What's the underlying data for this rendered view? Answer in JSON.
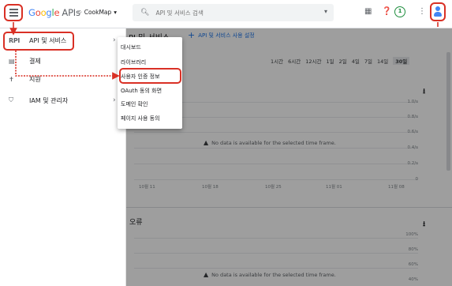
{
  "header": {
    "logo_letters": [
      "G",
      "o",
      "o",
      "g",
      "l",
      "e"
    ],
    "logo_suffix": "APIs",
    "project_name": "CookMap",
    "project_caret": "▾",
    "search_placeholder": "API 및 서비스 검색",
    "search_caret": "▾",
    "notification_count": "1"
  },
  "sidebar": {
    "items": [
      {
        "icon": "RPI",
        "label": "API 및 서비스",
        "chevron": "›"
      },
      {
        "icon": "▤",
        "label": "결제",
        "chevron": ""
      },
      {
        "icon": "✝",
        "label": "지원",
        "chevron": ""
      },
      {
        "icon": "⛉",
        "label": "IAM 및 관리자",
        "chevron": "›"
      }
    ]
  },
  "submenu": {
    "items": [
      "대시보드",
      "라이브러리",
      "사용자 인증 정보",
      "OAuth 동의 화면",
      "도메인 확인",
      "페이지 사용 동의"
    ]
  },
  "main": {
    "title": "PI 및 서비스",
    "enable_link_icon": "+",
    "enable_link": "API 및 서비스 사용 설정",
    "time_ranges": [
      "1시간",
      "6시간",
      "12시간",
      "1일",
      "2일",
      "4일",
      "7일",
      "14일",
      "30일"
    ],
    "active_range": "30일",
    "traffic_chart": {
      "y_ticks": [
        "1.0/s",
        "0.8/s",
        "0.6/s",
        "0.4/s",
        "0.2/s",
        "0"
      ],
      "x_ticks": [
        "10월 11",
        "10월 18",
        "10월 25",
        "11월 01",
        "11월 08"
      ],
      "no_data": "No data is available for the selected time frame."
    },
    "errors_chart": {
      "title": "오류",
      "y_ticks": [
        "100%",
        "80%",
        "60%",
        "40%"
      ],
      "no_data": "No data is available for the selected time frame."
    }
  },
  "colors": {
    "annotation_red": "#d93025",
    "link_blue": "#1a73e8",
    "notification_green": "#1e8e3e"
  }
}
